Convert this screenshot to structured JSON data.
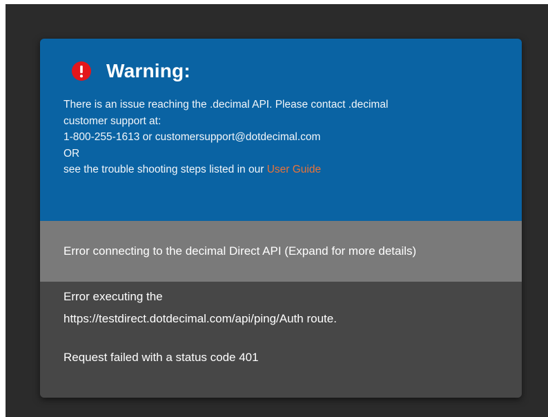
{
  "warning": {
    "icon": "exclamation-circle-icon",
    "icon_color": "#e3161b",
    "background_color": "#0a63a3",
    "title": "Warning:",
    "line1": "There is an issue reaching the .decimal API. Please contact .decimal",
    "line2": "customer support at:",
    "line3": "1-800-255-1613 or customersupport@dotdecimal.com",
    "line4": "OR",
    "line5_prefix": "see the trouble shooting steps listed in our ",
    "link_text": "User Guide",
    "link_color": "#e8733a"
  },
  "error_panel": {
    "summary": "Error connecting to the decimal Direct API (Expand for more details)",
    "detail_line1": "Error executing the",
    "detail_line2": "https://testdirect.dotdecimal.com/api/ping/Auth route.",
    "status_message": "Request failed with a status code 401"
  }
}
